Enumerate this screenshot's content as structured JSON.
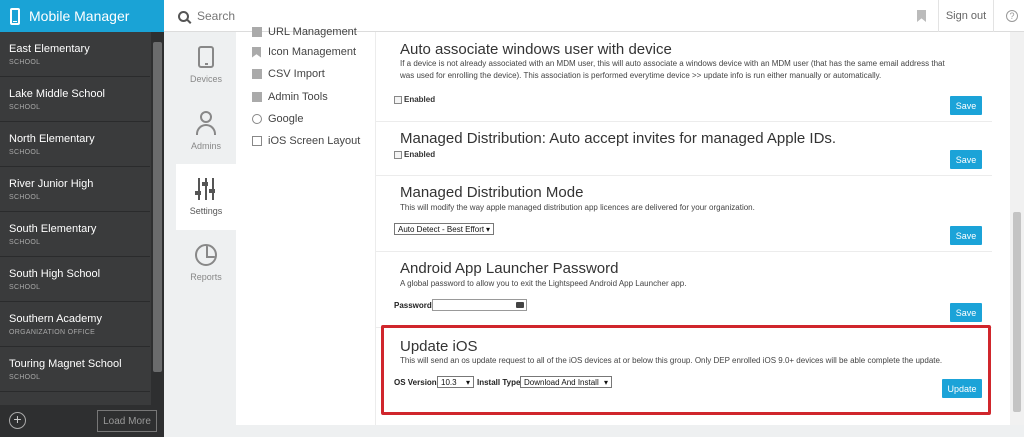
{
  "app": {
    "title": "Mobile Manager"
  },
  "header": {
    "search_placeholder": "Search",
    "signout_label": "Sign out",
    "help_label": "?"
  },
  "sidebar": {
    "schools": [
      {
        "name": "East Elementary",
        "type": "SCHOOL"
      },
      {
        "name": "Lake Middle School",
        "type": "SCHOOL"
      },
      {
        "name": "North Elementary",
        "type": "SCHOOL"
      },
      {
        "name": "River Junior High",
        "type": "SCHOOL"
      },
      {
        "name": "South Elementary",
        "type": "SCHOOL"
      },
      {
        "name": "South High School",
        "type": "SCHOOL"
      },
      {
        "name": "Southern Academy",
        "type": "ORGANIZATION OFFICE"
      },
      {
        "name": "Touring Magnet School",
        "type": "SCHOOL"
      }
    ],
    "load_more_label": "Load More",
    "add_label": "+"
  },
  "nav": {
    "devices": "Devices",
    "admins": "Admins",
    "settings": "Settings",
    "reports": "Reports"
  },
  "submenu": {
    "items": [
      "URL Management",
      "Icon Management",
      "CSV Import",
      "Admin Tools",
      "Google",
      "iOS Screen Layout"
    ]
  },
  "sections": {
    "auto_associate": {
      "title": "Auto associate windows user with device",
      "description": "If a device is not already associated with an MDM user, this will auto associate a windows device with an MDM user (that has the same email address that was used for enrolling the device). This association is performed everytime device >> update info is run either manually or automatically.",
      "enabled_label": "Enabled",
      "save_label": "Save"
    },
    "managed_invites": {
      "title": "Managed Distribution: Auto accept invites for managed Apple IDs.",
      "enabled_label": "Enabled",
      "save_label": "Save"
    },
    "managed_mode": {
      "title": "Managed Distribution Mode",
      "description": "This will modify the way apple managed distribution app licences are delivered for your organization.",
      "selected": "Auto Detect - Best Effort",
      "save_label": "Save"
    },
    "android_pw": {
      "title": "Android App Launcher Password",
      "description": "A global password to allow you to exit the Lightspeed Android App Launcher app.",
      "password_label": "Password",
      "save_label": "Save"
    },
    "update_ios": {
      "title": "Update iOS",
      "description": "This will send an os update request to all of the iOS devices at or below this group. Only DEP enrolled iOS 9.0+ devices will be able complete the update.",
      "os_version_label": "OS Version",
      "os_version_value": "10.3",
      "install_type_label": "Install Type",
      "install_type_value": "Download And Install",
      "update_label": "Update"
    }
  },
  "colors": {
    "brand": "#1aa3d6",
    "button": "#1ba3d8",
    "highlight": "#d0262c",
    "sidebar": "#3a3b3c"
  }
}
